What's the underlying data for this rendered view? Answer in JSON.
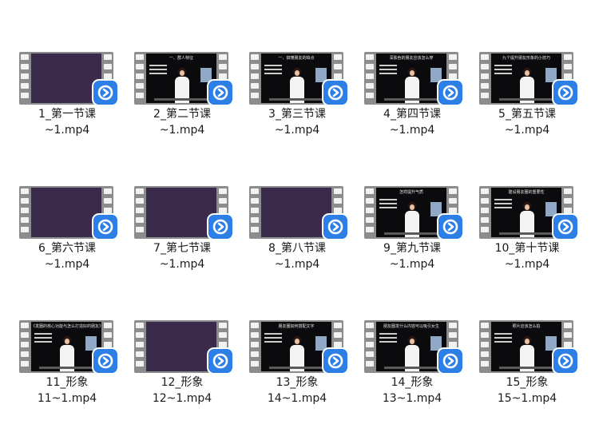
{
  "files": [
    {
      "line1": "1_第一节课",
      "line2": "~1.mp4",
      "frame": "purple",
      "caption": ""
    },
    {
      "line1": "2_第二节课",
      "line2": "~1.mp4",
      "frame": "black",
      "caption": "一、群人特征"
    },
    {
      "line1": "3_第三节课",
      "line2": "~1.mp4",
      "frame": "black",
      "caption": "一、搞懂朋友的缺点"
    },
    {
      "line1": "4_第四节课",
      "line2": "~1.mp4",
      "frame": "black",
      "caption": "深肤色的朋友应该怎么穿"
    },
    {
      "line1": "5_第五节课",
      "line2": "~1.mp4",
      "frame": "black",
      "caption": "九个提升朋友形象的小技巧"
    },
    {
      "line1": "6_第六节课",
      "line2": "~1.mp4",
      "frame": "purple",
      "caption": ""
    },
    {
      "line1": "7_第七节课",
      "line2": "~1.mp4",
      "frame": "purple",
      "caption": ""
    },
    {
      "line1": "8_第八节课",
      "line2": "~1.mp4",
      "frame": "purple",
      "caption": ""
    },
    {
      "line1": "9_第九节课",
      "line2": "~1.mp4",
      "frame": "black",
      "caption": "怎样提升气质"
    },
    {
      "line1": "10_第十节课",
      "line2": "~1.mp4",
      "frame": "black",
      "caption": "建设朋友圈的重要性"
    },
    {
      "line1": "11_形象",
      "line2": "11~1.mp4",
      "frame": "black",
      "caption": "《发圈的核心功能与怎么打造好的朋友》"
    },
    {
      "line1": "12_形象",
      "line2": "12~1.mp4",
      "frame": "purple",
      "caption": ""
    },
    {
      "line1": "13_形象",
      "line2": "14~1.mp4",
      "frame": "black",
      "caption": "朋友圈如何搭配文字"
    },
    {
      "line1": "14_形象",
      "line2": "13~1.mp4",
      "frame": "black",
      "caption": "朋友圈发什么内容可以吸引女生"
    },
    {
      "line1": "15_形象",
      "line2": "15~1.mp4",
      "frame": "black",
      "caption": "照片应该怎么拍"
    }
  ],
  "icons": {
    "badge": "video-player-icon",
    "badge_color": "#2b7fe6"
  }
}
